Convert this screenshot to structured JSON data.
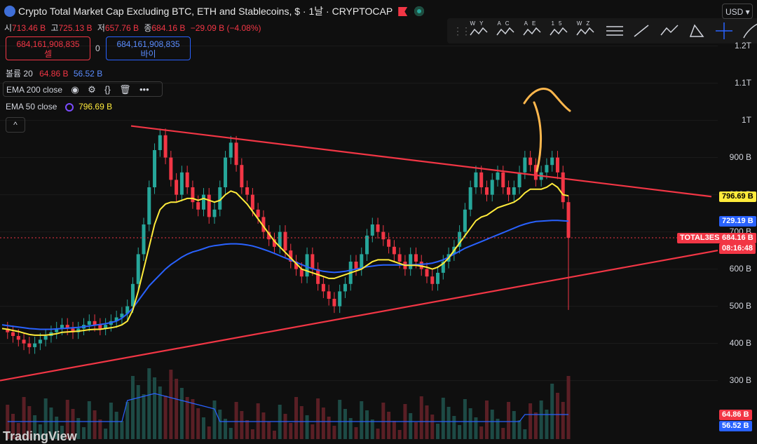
{
  "header": {
    "title": "Crypto Total Market Cap Excluding BTC, ETH and Stablecoins, $ · 1날 · CRYPTOCAP"
  },
  "ohlc": {
    "o_label": "시",
    "o": "713.46 B",
    "h_label": "고",
    "h": "725.13 B",
    "l_label": "저",
    "l": "657.76 B",
    "c_label": "종",
    "c": "684.16 B",
    "change": "−29.09 B (−4.08%)"
  },
  "trade": {
    "sell_price": "684,161,908,835",
    "sell_label": "셀",
    "spread": "0",
    "buy_price": "684,161,908,835",
    "buy_label": "바이"
  },
  "volume": {
    "label": "볼륨 20",
    "v1": "64.86 B",
    "v2": "56.52 B"
  },
  "indicators": {
    "ema200": "EMA 200 close",
    "ema50": "EMA 50 close",
    "ema50_value": "796.69 B",
    "icons": [
      "eye-icon",
      "settings-icon",
      "code-icon",
      "trash-icon",
      "more-icon"
    ]
  },
  "collapse_label": "^",
  "toolbar": {
    "tools": [
      {
        "icon": "pattern-wy-icon",
        "label": "WY"
      },
      {
        "icon": "pattern-ac-icon",
        "label": "AC"
      },
      {
        "icon": "pattern-ae-icon",
        "label": "AE"
      },
      {
        "icon": "pattern-15-icon",
        "label": "15"
      },
      {
        "icon": "pattern-wz-icon",
        "label": "WZ"
      },
      {
        "icon": "fib-icon",
        "label": ""
      },
      {
        "icon": "trendline-icon",
        "label": ""
      },
      {
        "icon": "path-icon",
        "label": ""
      },
      {
        "icon": "triangle-icon",
        "label": ""
      },
      {
        "icon": "crosshair-icon",
        "label": ""
      },
      {
        "icon": "brush-icon",
        "label": ""
      }
    ]
  },
  "currency": "USD",
  "price_axis": {
    "ticks": [
      "1.2T",
      "1.1T",
      "1T",
      "900 B",
      "800 B",
      "700 B",
      "600 B",
      "500 B",
      "400 B",
      "300 B"
    ],
    "ema50_tag": "796.69 B",
    "ema200_tag": "729.19 B",
    "symbol_tag": "TOTAL3ES",
    "price_tag": "684.16 B",
    "countdown": "08:16:48",
    "vol_tag1": "64.86 B",
    "vol_tag2": "56.52 B"
  },
  "colors": {
    "up": "#26a69a",
    "down": "#f23645",
    "ema50": "#ffeb3b",
    "ema200": "#2962ff",
    "trendline": "#f23645",
    "arrow": "#ffb74d",
    "volume_ma": "#2962ff"
  },
  "watermark": "TradingView",
  "chart_data": {
    "type": "line",
    "title": "Crypto Total Market Cap Excluding BTC, ETH and Stablecoins",
    "y_unit": "USD (B)",
    "ylim": [
      250,
      1250
    ],
    "close_series": [
      440,
      430,
      420,
      410,
      400,
      390,
      400,
      410,
      420,
      430,
      440,
      450,
      440,
      430,
      440,
      450,
      460,
      450,
      440,
      450,
      460,
      470,
      480,
      500,
      560,
      640,
      720,
      820,
      920,
      960,
      900,
      840,
      800,
      860,
      820,
      780,
      760,
      800,
      740,
      760,
      820,
      900,
      940,
      880,
      820,
      800,
      760,
      740,
      700,
      680,
      660,
      700,
      650,
      620,
      600,
      580,
      640,
      600,
      560,
      540,
      520,
      500,
      540,
      560,
      620,
      600,
      640,
      690,
      720,
      700,
      680,
      660,
      640,
      620,
      600,
      640,
      620,
      600,
      580,
      560,
      590,
      620,
      640,
      660,
      700,
      760,
      820,
      860,
      820,
      800,
      840,
      860,
      820,
      800,
      820,
      860,
      900,
      880,
      840,
      860,
      880,
      900,
      860,
      780,
      684
    ],
    "ema50": [
      440,
      438,
      435,
      432,
      428,
      424,
      422,
      422,
      422,
      424,
      426,
      430,
      431,
      432,
      433,
      435,
      437,
      438,
      438,
      440,
      442,
      445,
      450,
      460,
      490,
      540,
      600,
      660,
      720,
      760,
      775,
      780,
      780,
      785,
      790,
      790,
      785,
      790,
      785,
      780,
      785,
      800,
      810,
      805,
      790,
      775,
      755,
      735,
      715,
      695,
      675,
      660,
      645,
      630,
      615,
      600,
      595,
      590,
      585,
      580,
      575,
      575,
      580,
      585,
      590,
      595,
      600,
      610,
      620,
      625,
      625,
      625,
      620,
      615,
      610,
      610,
      610,
      608,
      605,
      600,
      605,
      615,
      630,
      650,
      670,
      690,
      710,
      730,
      740,
      745,
      755,
      765,
      770,
      775,
      780,
      790,
      805,
      815,
      815,
      815,
      820,
      830,
      820,
      800,
      797
    ],
    "ema200": [
      450,
      448,
      446,
      444,
      442,
      440,
      439,
      438,
      438,
      438,
      439,
      440,
      441,
      442,
      443,
      445,
      447,
      449,
      451,
      453,
      456,
      460,
      468,
      480,
      495,
      515,
      535,
      555,
      570,
      585,
      600,
      612,
      622,
      632,
      640,
      646,
      650,
      655,
      660,
      663,
      665,
      667,
      668,
      668,
      667,
      665,
      662,
      658,
      653,
      648,
      642,
      636,
      630,
      624,
      618,
      612,
      606,
      601,
      597,
      594,
      592,
      591,
      592,
      594,
      597,
      600,
      603,
      606,
      608,
      610,
      611,
      611,
      611,
      611,
      611,
      611,
      612,
      613,
      614,
      616,
      620,
      625,
      632,
      640,
      648,
      656,
      662,
      668,
      674,
      680,
      686,
      692,
      698,
      704,
      710,
      716,
      721,
      725,
      728,
      729,
      730,
      731,
      731,
      730,
      729
    ],
    "trendlines": [
      {
        "name": "upper resistance",
        "from": 985,
        "to": 795
      },
      {
        "name": "lower support",
        "from": 300,
        "to": 650
      }
    ],
    "last_price": 684.16
  }
}
